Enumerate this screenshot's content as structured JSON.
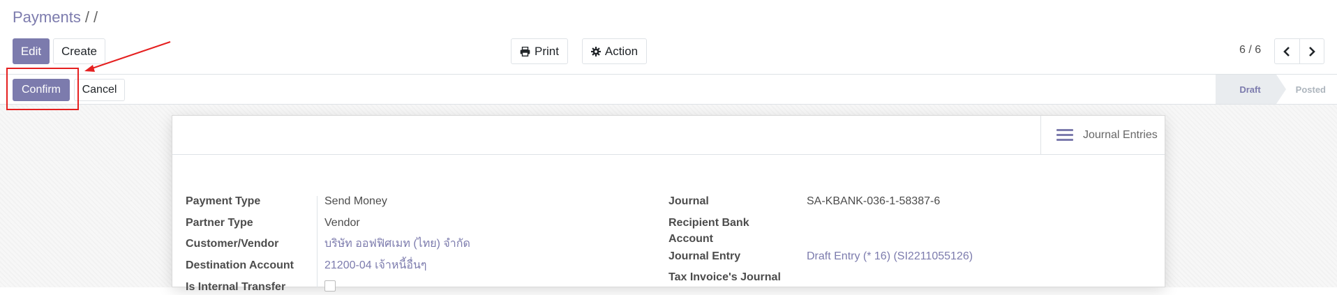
{
  "breadcrumb": {
    "root": "Payments",
    "sep1": "/",
    "sep2": "/"
  },
  "toolbar": {
    "edit_label": "Edit",
    "create_label": "Create",
    "print_label": "Print",
    "action_label": "Action"
  },
  "pager": {
    "value": "6 / 6"
  },
  "statusbar": {
    "confirm_label": "Confirm",
    "cancel_label": "Cancel",
    "stages": [
      {
        "label": "Draft",
        "active": true
      },
      {
        "label": "Posted",
        "active": false
      }
    ]
  },
  "smart_buttons": {
    "journal_entries_label": "Journal Entries"
  },
  "form": {
    "left": [
      {
        "label": "Payment Type",
        "value": "Send Money"
      },
      {
        "label": "Partner Type",
        "value": "Vendor"
      },
      {
        "label": "Customer/Vendor",
        "value": "บริษัท ออฟฟิศเมท (ไทย) จำกัด"
      },
      {
        "label": "Destination Account",
        "value": "21200-04 เจ้าหนี้อื่นๆ"
      },
      {
        "label": "Is Internal Transfer",
        "value": ""
      }
    ],
    "right": [
      {
        "label": "Journal",
        "value": "SA-KBANK-036-1-58387-6"
      },
      {
        "label": "Recipient Bank Account",
        "value": ""
      },
      {
        "label": "Journal Entry",
        "value": "Draft Entry (* 16) (SI2211055126)"
      },
      {
        "label": "Tax Invoice's Journal",
        "value": ""
      }
    ],
    "recipient_line1": "Recipient Bank",
    "recipient_line2": "Account"
  },
  "colors": {
    "primary": "#7c7bad",
    "annotation": "#e52020"
  },
  "icons": {
    "print": "printer-icon",
    "action": "gear-icon",
    "prev": "chevron-left-icon",
    "next": "chevron-right-icon",
    "journal": "bars-icon"
  }
}
